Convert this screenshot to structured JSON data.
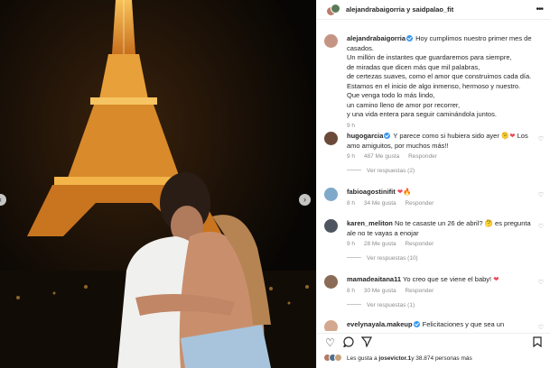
{
  "header": {
    "users": "alejandrabaigorria y saidpalao_fit"
  },
  "caption": {
    "username": "alejandrabaigorria",
    "lines": [
      "Hoy cumplimos nuestro primer mes de",
      "casados.",
      "Un millón de instantes que guardaremos para siempre,",
      "de miradas que dicen más que mil palabras,",
      "de certezas suaves, como el amor que construimos cada día.",
      "Estamos en el inicio de algo inmenso, hermoso y nuestro.",
      "Que venga todo lo más lindo,",
      "un camino lleno de amor por recorrer,",
      "y una vida entera para seguir caminándola juntos."
    ],
    "time": "9 h"
  },
  "comments": [
    {
      "username": "hugogarcia",
      "text_a": "Y parece como si hubiera sido ayer ",
      "text_b": " Los amo amiguitos, por muchos más!!",
      "time": "9 h",
      "likes": "487 Me gusta",
      "reply": "Responder",
      "replies": "Ver respuestas (2)"
    },
    {
      "username": "fabioagostinifit",
      "text": "",
      "time": "8 h",
      "likes": "34 Me gusta",
      "reply": "Responder"
    },
    {
      "username": "karen_meliton",
      "text": "No te casaste un 26 de abril? 🤔 es pregunta ale no te vayas a enojar",
      "time": "9 h",
      "likes": "28 Me gusta",
      "reply": "Responder",
      "replies": "Ver respuestas (10)"
    },
    {
      "username": "mamadeaitana11",
      "text": "Yo creo que se viene el baby! ",
      "time": "8 h",
      "likes": "30 Me gusta",
      "reply": "Responder",
      "replies": "Ver respuestas (1)"
    },
    {
      "username": "evelynayala.makeup",
      "text": "Felicitaciones y que sea un matrimonio"
    }
  ],
  "likes": {
    "prefix": "Les gusta a ",
    "user": "josevictor.1",
    "suffix": " y 38.874 personas más"
  },
  "icons": {
    "heart": "heart-icon",
    "comment": "comment-icon",
    "share": "share-icon",
    "save": "bookmark-icon",
    "more": "more-icon"
  },
  "colors": {
    "verified": "#3897f0",
    "like": "#ed4956"
  }
}
